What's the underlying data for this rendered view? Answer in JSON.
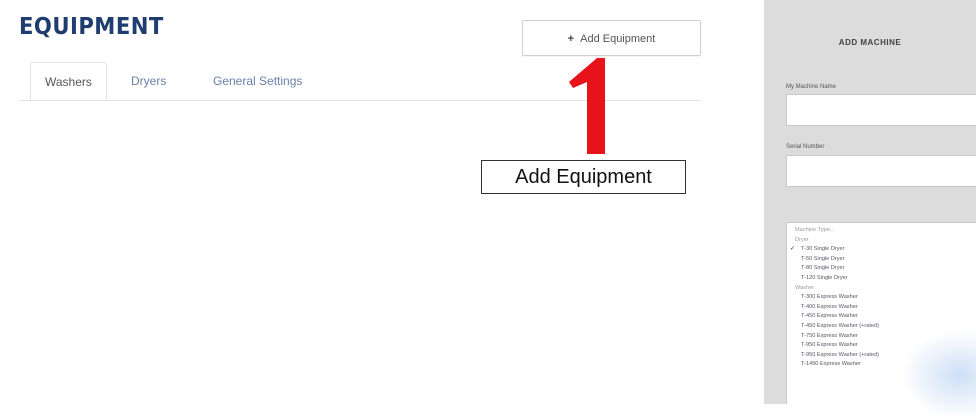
{
  "header": {
    "title": "EQUIPMENT",
    "add_button_label": "Add Equipment",
    "add_button_icon": "plus-icon"
  },
  "tabs": [
    {
      "label": "Washers",
      "active": true
    },
    {
      "label": "Dryers",
      "active": false
    },
    {
      "label": "General Settings",
      "active": false
    }
  ],
  "annotation": {
    "number": "1",
    "label": "Add Equipment",
    "color": "#e8121b"
  },
  "panel": {
    "title": "ADD MACHINE",
    "name_label": "My Machine Name",
    "serial_label": "Serial Number",
    "options": [
      {
        "label": "Machine Type...",
        "kind": "placeholder"
      },
      {
        "label": "Dryer",
        "kind": "header"
      },
      {
        "label": "T-30 Single Dryer",
        "kind": "item",
        "selected": true
      },
      {
        "label": "T-50 Single Dryer",
        "kind": "item"
      },
      {
        "label": "T-80 Single Dryer",
        "kind": "item"
      },
      {
        "label": "T-120 Single Dryer",
        "kind": "item"
      },
      {
        "label": "Washer",
        "kind": "header"
      },
      {
        "label": "T-300 Express Washer",
        "kind": "item"
      },
      {
        "label": "T-400 Express Washer",
        "kind": "item"
      },
      {
        "label": "T-450 Express Washer",
        "kind": "item"
      },
      {
        "label": "T-450 Express Washer (+rated)",
        "kind": "item"
      },
      {
        "label": "T-750 Express Washer",
        "kind": "item"
      },
      {
        "label": "T-950 Express Washer",
        "kind": "item"
      },
      {
        "label": "T-950 Express Washer (+rated)",
        "kind": "item"
      },
      {
        "label": "T-1450 Express Washer",
        "kind": "item"
      }
    ]
  },
  "colors": {
    "title": "#1f3d6e",
    "tab_link": "#6a7fa8",
    "annotation_red": "#e8121b"
  }
}
